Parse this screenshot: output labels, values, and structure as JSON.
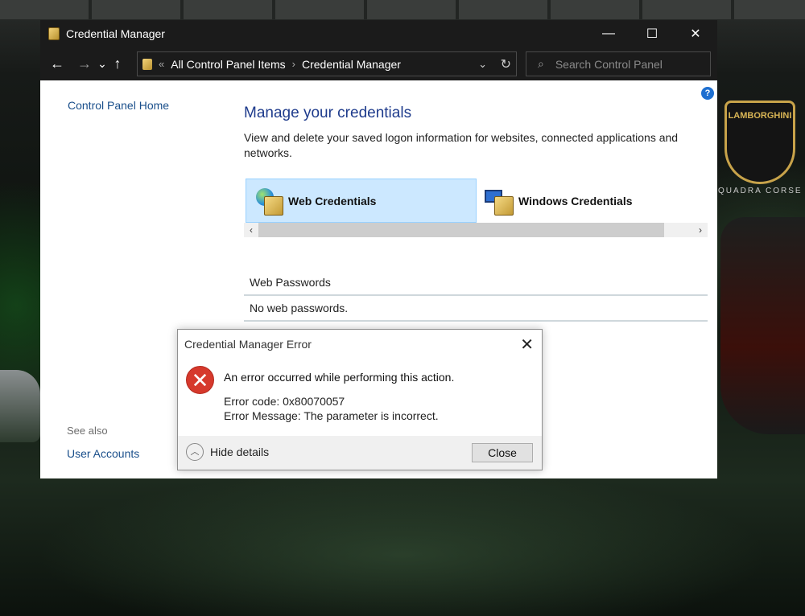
{
  "window": {
    "title": "Credential Manager",
    "controls": {
      "minimize": "—",
      "maximize": "☐",
      "close": "✕"
    }
  },
  "nav": {
    "back": "←",
    "forward": "→",
    "recent": "⌄",
    "up": "↑",
    "breadcrumb_prefix": "«",
    "breadcrumb": [
      "All Control Panel Items",
      "Credential Manager"
    ],
    "separator": "›",
    "dropdown": "⌄",
    "refresh": "↻",
    "search_placeholder": "Search Control Panel",
    "search_icon": "⌕"
  },
  "sidebar": {
    "home_link": "Control Panel Home",
    "see_also_label": "See also",
    "user_accounts_link": "User Accounts"
  },
  "main": {
    "help": "?",
    "title": "Manage your credentials",
    "description": "View and delete your saved logon information for websites, connected applications and networks.",
    "tabs": [
      {
        "label": "Web Credentials",
        "icon": "web-credentials-icon",
        "active": true
      },
      {
        "label": "Windows Credentials",
        "icon": "windows-credentials-icon",
        "active": false
      }
    ],
    "scroll_left": "‹",
    "scroll_right": "›",
    "section_heading": "Web Passwords",
    "section_body": "No web passwords."
  },
  "dialog": {
    "title": "Credential Manager Error",
    "close_x": "✕",
    "error_icon": "✕",
    "message": "An error occurred while performing this action.",
    "error_code": "Error code: 0x80070057",
    "error_message": "Error Message: The parameter is incorrect.",
    "hide_details_icon": "︿",
    "hide_details": "Hide details",
    "close_button": "Close"
  },
  "wallpaper": {
    "logo_text": "LAMBORGHINI",
    "logo_subtext": "QUADRA CORSE"
  }
}
